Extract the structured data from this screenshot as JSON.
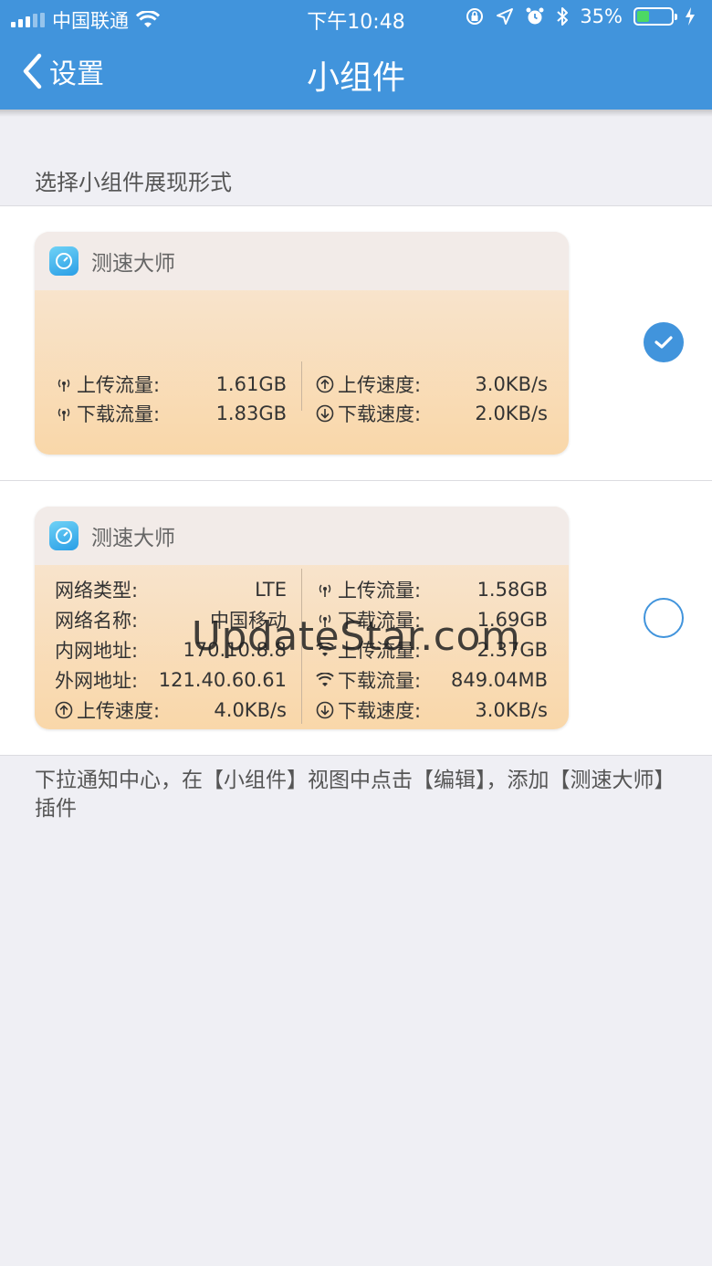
{
  "status_bar": {
    "carrier": "中国联通",
    "time": "下午10:48",
    "battery": "35%",
    "battery_level": 0.35
  },
  "nav": {
    "back_label": "设置",
    "title": "小组件"
  },
  "section_title": "选择小组件展现形式",
  "options": [
    {
      "app_name": "测速大师",
      "selected": true,
      "left_rows": [
        {
          "icon": "antenna-icon",
          "label": "上传流量:",
          "value": "1.61GB"
        },
        {
          "icon": "antenna-icon",
          "label": "下载流量:",
          "value": "1.83GB"
        }
      ],
      "right_rows": [
        {
          "icon": "upload-circle-icon",
          "label": "上传速度:",
          "value": "3.0KB/s"
        },
        {
          "icon": "download-circle-icon",
          "label": "下载速度:",
          "value": "2.0KB/s"
        }
      ]
    },
    {
      "app_name": "测速大师",
      "selected": false,
      "left_rows": [
        {
          "icon": "",
          "label": "网络类型:",
          "value": "LTE"
        },
        {
          "icon": "",
          "label": "网络名称:",
          "value": "中国移动"
        },
        {
          "icon": "",
          "label": "内网地址:",
          "value": "170.10.8.8"
        },
        {
          "icon": "",
          "label": "外网地址:",
          "value": "121.40.60.61"
        },
        {
          "icon": "upload-circle-icon",
          "label": "上传速度:",
          "value": "4.0KB/s"
        }
      ],
      "right_rows": [
        {
          "icon": "antenna-icon",
          "label": "上传流量:",
          "value": "1.58GB"
        },
        {
          "icon": "antenna-icon",
          "label": "下载流量:",
          "value": "1.69GB"
        },
        {
          "icon": "wifi-icon",
          "label": "上传流量:",
          "value": "2.37GB"
        },
        {
          "icon": "wifi-icon",
          "label": "下载流量:",
          "value": "849.04MB"
        },
        {
          "icon": "download-circle-icon",
          "label": "下载速度:",
          "value": "3.0KB/s"
        }
      ]
    }
  ],
  "footer_note": "下拉通知中心，在【小组件】视图中点击【编辑】，添加【测速大师】插件",
  "watermark": "UpdateStar.com",
  "colors": {
    "accent": "#4194dc",
    "background": "#efeff4"
  }
}
